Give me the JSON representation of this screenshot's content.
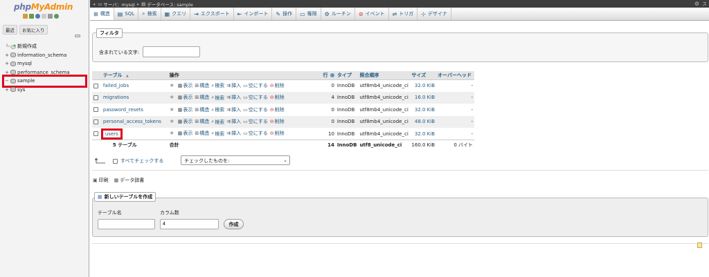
{
  "sidebar": {
    "logo_part1": "php",
    "logo_part2": "MyAdmin",
    "recent_tab": "最近",
    "favorites_tab": "お気に入り",
    "items": [
      {
        "label": "新規作成"
      },
      {
        "label": "information_schema"
      },
      {
        "label": "mysql"
      },
      {
        "label": "performance_schema"
      },
      {
        "label": "sample"
      },
      {
        "label": "sys"
      }
    ]
  },
  "topbar": {
    "server_label": "サーバ：mysql",
    "db_label": "データベース: sample"
  },
  "menu": [
    {
      "label": "構造",
      "icon": "structure-icon"
    },
    {
      "label": "SQL",
      "icon": "sql-icon"
    },
    {
      "label": "検索",
      "icon": "search-icon"
    },
    {
      "label": "クエリ",
      "icon": "query-icon"
    },
    {
      "label": "エクスポート",
      "icon": "export-icon"
    },
    {
      "label": "インポート",
      "icon": "import-icon"
    },
    {
      "label": "操作",
      "icon": "operations-icon"
    },
    {
      "label": "権限",
      "icon": "privileges-icon"
    },
    {
      "label": "ルーチン",
      "icon": "routines-icon"
    },
    {
      "label": "イベント",
      "icon": "events-icon"
    },
    {
      "label": "トリガ",
      "icon": "triggers-icon"
    },
    {
      "label": "デザイナ",
      "icon": "designer-icon"
    }
  ],
  "filter": {
    "legend": "フィルタ",
    "label": "含まれている文字:",
    "value": ""
  },
  "table": {
    "headers": {
      "table": "テーブル",
      "sort_arrow": "▲",
      "actions": "操作",
      "rows": "行",
      "type": "タイプ",
      "collation": "照合順序",
      "size": "サイズ",
      "overhead": "オーバーヘッド"
    },
    "action_labels": {
      "browse": "表示",
      "structure": "構造",
      "search": "検索",
      "insert": "挿入",
      "empty": "空にする",
      "drop": "削除"
    },
    "rows": [
      {
        "name": "failed_jobs",
        "rows": "0",
        "type": "InnoDB",
        "collation": "utf8mb4_unicode_ci",
        "size": "32.0 KiB",
        "overhead": "-"
      },
      {
        "name": "migrations",
        "rows": "4",
        "type": "InnoDB",
        "collation": "utf8mb4_unicode_ci",
        "size": "16.0 KiB",
        "overhead": "-"
      },
      {
        "name": "password_resets",
        "rows": "0",
        "type": "InnoDB",
        "collation": "utf8mb4_unicode_ci",
        "size": "32.0 KiB",
        "overhead": "-"
      },
      {
        "name": "personal_access_tokens",
        "rows": "0",
        "type": "InnoDB",
        "collation": "utf8mb4_unicode_ci",
        "size": "48.0 KiB",
        "overhead": "-"
      },
      {
        "name": "users",
        "rows": "10",
        "type": "InnoDB",
        "collation": "utf8mb4_unicode_ci",
        "size": "32.0 KiB",
        "overhead": "-"
      }
    ],
    "footer": {
      "count": "5 テーブル",
      "total": "合計",
      "rows": "14",
      "type": "InnoDB",
      "collation": "utf8_unicode_ci",
      "size": "160.0 KiB",
      "overhead": "0 バイト"
    }
  },
  "bulk": {
    "check_all": "すべてチェックする",
    "select_value": "チェックしたものを:"
  },
  "links": {
    "print": "印刷",
    "data_dictionary": "データ辞書"
  },
  "create": {
    "legend": "新しいテーブルを作成",
    "name_label": "テーブル名",
    "name_value": "",
    "columns_label": "カラム数",
    "columns_value": "4",
    "button": "作成"
  }
}
